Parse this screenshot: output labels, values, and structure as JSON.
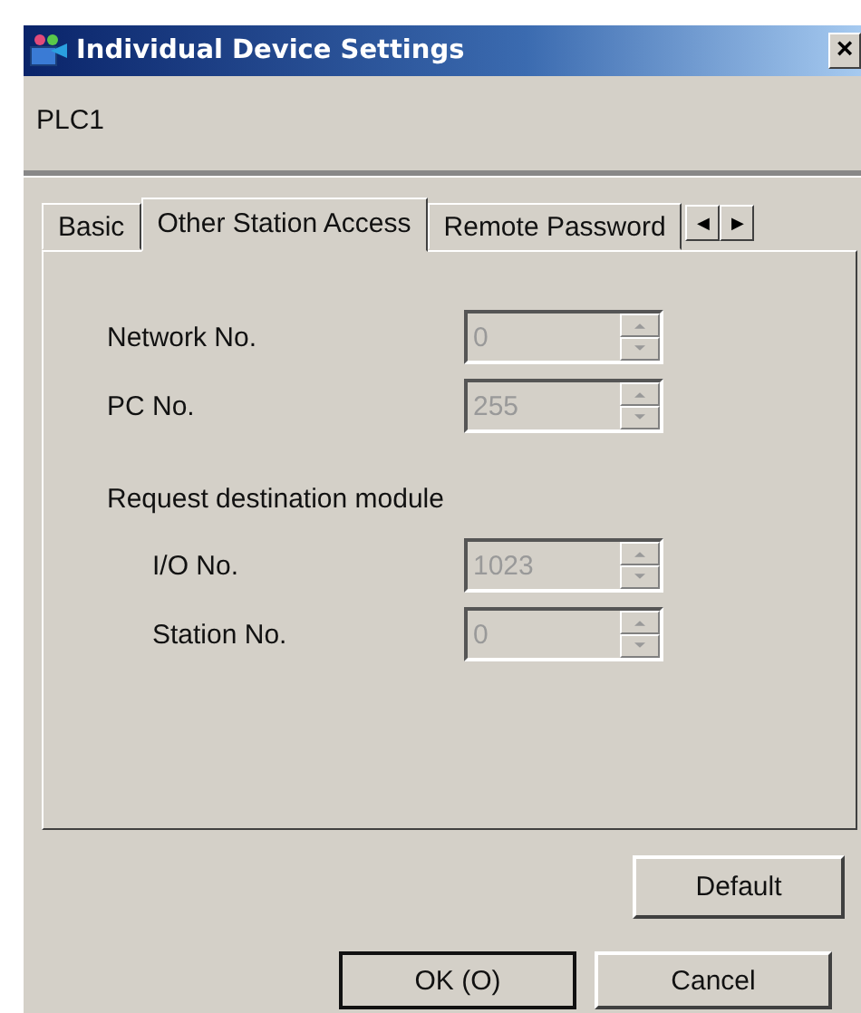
{
  "window": {
    "title": "Individual Device Settings",
    "close": "×"
  },
  "device": "PLC1",
  "tabs": [
    {
      "label": "Basic",
      "selected": false
    },
    {
      "label": "Other Station Access",
      "selected": true
    },
    {
      "label": "Remote Password",
      "selected": false
    }
  ],
  "tab_scroll": {
    "left": "◀",
    "right": "▶"
  },
  "fields": [
    {
      "kind": "field",
      "label": "Network No.",
      "value": "0",
      "disabled": true
    },
    {
      "kind": "field",
      "label": "PC No.",
      "value": "255",
      "disabled": true
    },
    {
      "kind": "heading",
      "label": "Request destination module"
    },
    {
      "kind": "subfield",
      "label": "I/O No.",
      "value": "1023",
      "disabled": true
    },
    {
      "kind": "subfield",
      "label": "Station No.",
      "value": "0",
      "disabled": true
    }
  ],
  "default_button": "Default",
  "buttons": [
    {
      "label": "OK (O)",
      "default": true
    },
    {
      "label": "Cancel",
      "default": false
    }
  ]
}
